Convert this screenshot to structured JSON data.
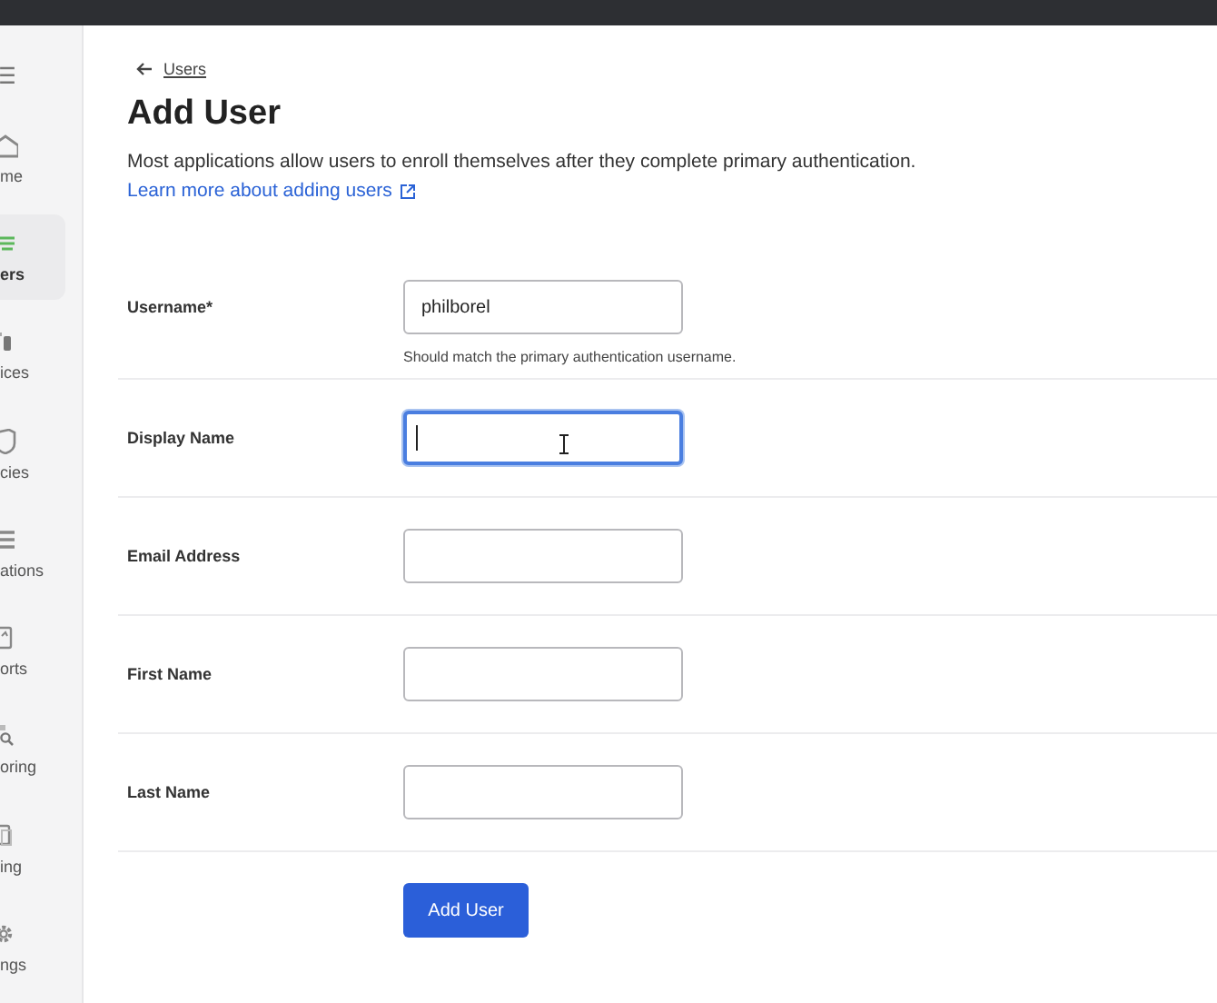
{
  "sidebar": {
    "items": [
      {
        "label": "me",
        "selected": false
      },
      {
        "label": "ers",
        "selected": true
      },
      {
        "label": "ices",
        "selected": false
      },
      {
        "label": "cies",
        "selected": false
      },
      {
        "label": "ations",
        "selected": false
      },
      {
        "label": "orts",
        "selected": false
      },
      {
        "label": "oring",
        "selected": false
      },
      {
        "label": "ing",
        "selected": false
      },
      {
        "label": "ngs",
        "selected": false
      }
    ]
  },
  "breadcrumb": {
    "label": "Users"
  },
  "title": "Add User",
  "description": "Most applications allow users to enroll themselves after they complete primary authentication.",
  "learn_more": "Learn more about adding users",
  "fields": [
    {
      "label": "Username*",
      "value": "philborel",
      "hint": "Should match the primary authentication username.",
      "focused": false
    },
    {
      "label": "Display Name",
      "focused": true
    },
    {
      "label": "Email Address",
      "focused": false
    },
    {
      "label": "First Name",
      "focused": false
    },
    {
      "label": "Last Name",
      "focused": false
    }
  ],
  "submit": "Add User"
}
